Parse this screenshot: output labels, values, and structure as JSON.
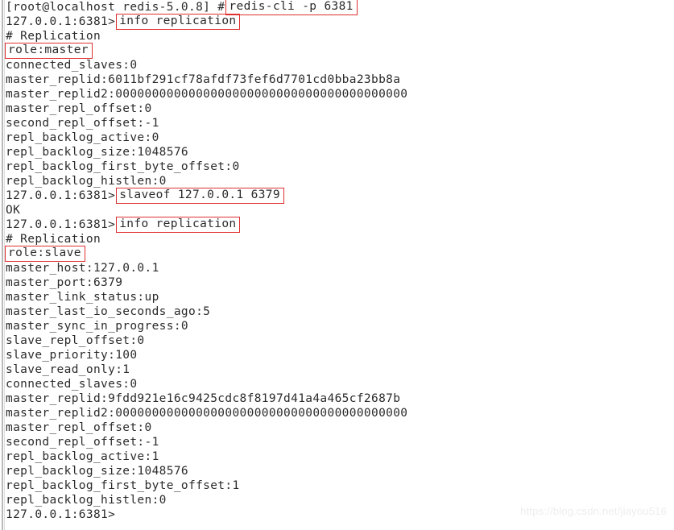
{
  "terminal": {
    "background": "#ffffff",
    "foreground": "#2b2b2b",
    "highlight_color": "#e03030",
    "shell_prompt": "[root@localhost redis-5.0.8] #",
    "redis_prompt": "127.0.0.1:6381>",
    "lines": [
      {
        "id": "l01",
        "prompt": "[root@localhost redis-5.0.8] #",
        "command": "redis-cli -p 6381",
        "highlight": true
      },
      {
        "id": "l02",
        "prompt": "127.0.0.1:6381>",
        "command": "info replication",
        "highlight": true
      },
      {
        "id": "l03",
        "text": "# Replication"
      },
      {
        "id": "l04",
        "text": "role:master",
        "highlight": true
      },
      {
        "id": "l05",
        "text": "connected_slaves:0"
      },
      {
        "id": "l06",
        "text": "master_replid:6011bf291cf78afdf73fef6d7701cd0bba23bb8a"
      },
      {
        "id": "l07",
        "text": "master_replid2:0000000000000000000000000000000000000000"
      },
      {
        "id": "l08",
        "text": "master_repl_offset:0"
      },
      {
        "id": "l09",
        "text": "second_repl_offset:-1"
      },
      {
        "id": "l10",
        "text": "repl_backlog_active:0"
      },
      {
        "id": "l11",
        "text": "repl_backlog_size:1048576"
      },
      {
        "id": "l12",
        "text": "repl_backlog_first_byte_offset:0"
      },
      {
        "id": "l13",
        "text": "repl_backlog_histlen:0"
      },
      {
        "id": "l14",
        "prompt": "127.0.0.1:6381>",
        "command": "slaveof 127.0.0.1 6379",
        "highlight": true
      },
      {
        "id": "l15",
        "text": "OK"
      },
      {
        "id": "l16",
        "prompt": "127.0.0.1:6381>",
        "command": "info replication",
        "highlight": true
      },
      {
        "id": "l17",
        "text": "# Replication"
      },
      {
        "id": "l18",
        "text": "role:slave",
        "highlight": true
      },
      {
        "id": "l19",
        "text": "master_host:127.0.0.1"
      },
      {
        "id": "l20",
        "text": "master_port:6379"
      },
      {
        "id": "l21",
        "text": "master_link_status:up"
      },
      {
        "id": "l22",
        "text": "master_last_io_seconds_ago:5"
      },
      {
        "id": "l23",
        "text": "master_sync_in_progress:0"
      },
      {
        "id": "l24",
        "text": "slave_repl_offset:0"
      },
      {
        "id": "l25",
        "text": "slave_priority:100"
      },
      {
        "id": "l26",
        "text": "slave_read_only:1"
      },
      {
        "id": "l27",
        "text": "connected_slaves:0"
      },
      {
        "id": "l28",
        "text": "master_replid:9fdd921e16c9425cdc8f8197d41a4a465cf2687b"
      },
      {
        "id": "l29",
        "text": "master_replid2:0000000000000000000000000000000000000000"
      },
      {
        "id": "l30",
        "text": "master_repl_offset:0"
      },
      {
        "id": "l31",
        "text": "second_repl_offset:-1"
      },
      {
        "id": "l32",
        "text": "repl_backlog_active:1"
      },
      {
        "id": "l33",
        "text": "repl_backlog_size:1048576"
      },
      {
        "id": "l34",
        "text": "repl_backlog_first_byte_offset:1"
      },
      {
        "id": "l35",
        "text": "repl_backlog_histlen:0"
      },
      {
        "id": "l36",
        "prompt": "127.0.0.1:6381>",
        "command": ""
      }
    ]
  },
  "watermark": {
    "text": "https://blog.csdn.net/jiayou516"
  }
}
